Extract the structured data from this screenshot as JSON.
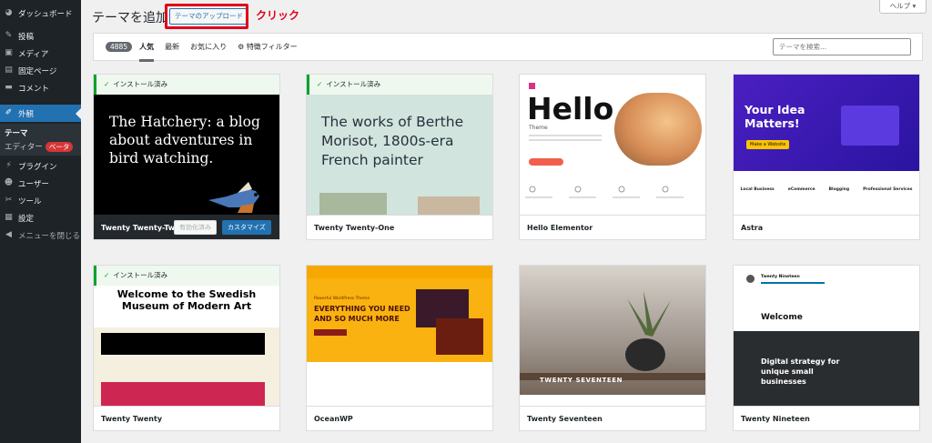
{
  "sidebar": {
    "items": [
      {
        "label": "ダッシュボード",
        "icon": "dashboard-icon"
      },
      {
        "label": "投稿",
        "icon": "pin-icon"
      },
      {
        "label": "メディア",
        "icon": "media-icon"
      },
      {
        "label": "固定ページ",
        "icon": "page-icon"
      },
      {
        "label": "コメント",
        "icon": "comment-icon"
      },
      {
        "label": "外観",
        "icon": "brush-icon"
      },
      {
        "label": "プラグイン",
        "icon": "plugin-icon"
      },
      {
        "label": "ユーザー",
        "icon": "user-icon"
      },
      {
        "label": "ツール",
        "icon": "wrench-icon"
      },
      {
        "label": "設定",
        "icon": "settings-icon"
      },
      {
        "label": "メニューを閉じる",
        "icon": "collapse-icon"
      }
    ],
    "submenu": {
      "current": "テーマ",
      "editor": "エディター",
      "editor_badge": "ベータ"
    }
  },
  "header": {
    "title": "テーマを追加",
    "upload_label": "テーマのアップロード",
    "annotation": "クリック",
    "help_label": "ヘルプ ▾"
  },
  "filter": {
    "count": "4885",
    "tabs": [
      "人気",
      "最新",
      "お気に入り"
    ],
    "feature_filter": "特徴フィルター",
    "search_placeholder": "テーマを検索..."
  },
  "installed_label": "インストール済み",
  "card_buttons": {
    "activated": "有効化済み",
    "customize": "カスタマイズ"
  },
  "themes": [
    {
      "name": "Twenty Twenty-Two",
      "installed": true,
      "preview": "The Hatchery: a blog about adventures in bird watching."
    },
    {
      "name": "Twenty Twenty-One",
      "installed": true,
      "preview": "The works of Berthe Morisot, 1800s-era French painter"
    },
    {
      "name": "Hello Elementor",
      "installed": false,
      "preview": "Hello",
      "preview_sub": "Theme"
    },
    {
      "name": "Astra",
      "installed": false,
      "preview": "Your Idea Matters!",
      "preview_btn": "Make a Website",
      "features": [
        "Local Business",
        "eCommerce",
        "Blogging",
        "Professional Services"
      ]
    },
    {
      "name": "Twenty Twenty",
      "installed": true,
      "preview": "Welcome to the Swedish Museum of Modern Art"
    },
    {
      "name": "OceanWP",
      "installed": false,
      "preview": "EVERYTHING YOU NEED AND SO MUCH MORE",
      "preview_top": "Powerful WordPress Theme"
    },
    {
      "name": "Twenty Seventeen",
      "installed": false,
      "preview": "TWENTY SEVENTEEN"
    },
    {
      "name": "Twenty Nineteen",
      "installed": false,
      "preview": "Welcome",
      "preview_dark": "Digital strategy for unique small businesses",
      "preview_site": "Twenty Nineteen"
    }
  ],
  "colors": {
    "accent": "#2271b1",
    "sidebar": "#1d2327",
    "highlight": "#e0001a",
    "installed": "#00a32a"
  }
}
